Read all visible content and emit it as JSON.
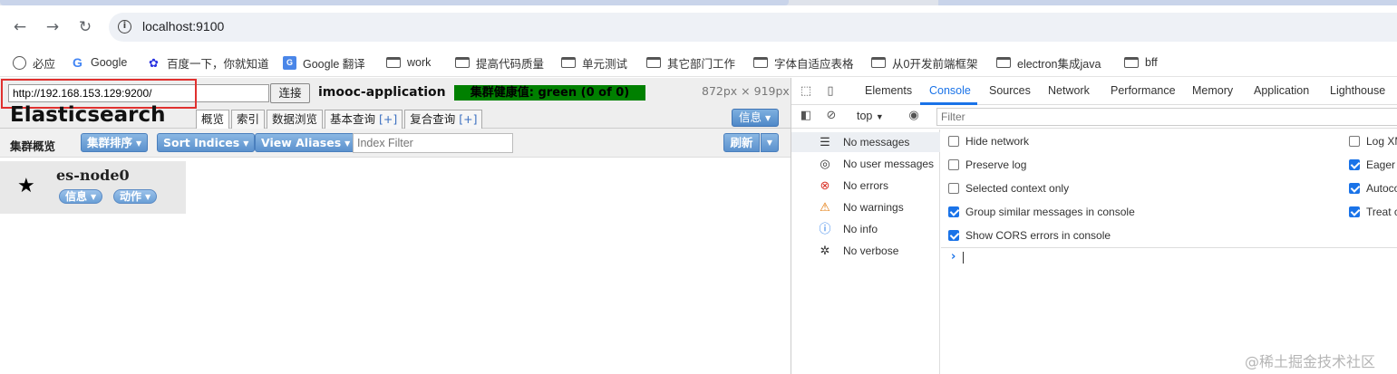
{
  "browser": {
    "url": "localhost:9100",
    "bookmarks": [
      {
        "label": "必应",
        "icon": "globe-icon"
      },
      {
        "label": "Google",
        "icon": "google-icon"
      },
      {
        "label": "百度一下，你就知道",
        "icon": "baidu-icon"
      },
      {
        "label": "Google 翻译",
        "icon": "google-translate-icon"
      },
      {
        "label": "work",
        "icon": "folder-icon"
      },
      {
        "label": "提高代码质量",
        "icon": "folder-icon"
      },
      {
        "label": "单元测试",
        "icon": "folder-icon"
      },
      {
        "label": "其它部门工作",
        "icon": "folder-icon"
      },
      {
        "label": "字体自适应表格",
        "icon": "folder-icon"
      },
      {
        "label": "从0开发前端框架",
        "icon": "folder-icon"
      },
      {
        "label": "electron集成java",
        "icon": "folder-icon"
      },
      {
        "label": "bff",
        "icon": "folder-icon"
      }
    ]
  },
  "head": {
    "uri_value": "http://192.168.153.129:9200/",
    "connect_label": "连接",
    "cluster_name": "imooc-application",
    "health_text": "集群健康值: green (0 of 0)",
    "dims": "872px × 919px",
    "logo": "Elasticsearch",
    "tabs": [
      {
        "label": "概览",
        "plus": ""
      },
      {
        "label": "索引",
        "plus": ""
      },
      {
        "label": "数据浏览",
        "plus": ""
      },
      {
        "label": "基本查询 ",
        "plus": "[+]"
      },
      {
        "label": "复合查询 ",
        "plus": "[+]"
      }
    ],
    "info_label": "信息"
  },
  "overview": {
    "title": "集群概览",
    "sort_label": "集群排序",
    "sort_indices_label": "Sort Indices",
    "view_aliases_label": "View Aliases",
    "index_filter_placeholder": "Index Filter",
    "refresh_label": "刷新"
  },
  "node": {
    "name": "es-node0",
    "info_label": "信息",
    "action_label": "动作"
  },
  "devtools": {
    "tabs": [
      "Elements",
      "Console",
      "Sources",
      "Network",
      "Performance",
      "Memory",
      "Application",
      "Lighthouse"
    ],
    "active_tab": "Console",
    "context": "top",
    "filter_placeholder": "Filter",
    "sidebar": [
      {
        "label": "No messages",
        "icon": "list-icon"
      },
      {
        "label": "No user messages",
        "icon": "user-icon"
      },
      {
        "label": "No errors",
        "icon": "error-icon"
      },
      {
        "label": "No warnings",
        "icon": "warning-icon"
      },
      {
        "label": "No info",
        "icon": "info-icon"
      },
      {
        "label": "No verbose",
        "icon": "bug-icon"
      }
    ],
    "settings_left": [
      {
        "label": "Hide network",
        "checked": false
      },
      {
        "label": "Preserve log",
        "checked": false
      },
      {
        "label": "Selected context only",
        "checked": false
      },
      {
        "label": "Group similar messages in console",
        "checked": true
      },
      {
        "label": "Show CORS errors in console",
        "checked": true
      }
    ],
    "settings_right": [
      {
        "label": "Log XM",
        "checked": false
      },
      {
        "label": "Eager e",
        "checked": true
      },
      {
        "label": "Autoco",
        "checked": true
      },
      {
        "label": "Treat c",
        "checked": true
      }
    ],
    "prompt": "›"
  },
  "watermark": "@稀土掘金技术社区",
  "colors": {
    "health_green": "#008000",
    "highlight_red": "#e0312f",
    "devtools_accent": "#1a73e8",
    "button_blue": "#5b91cd"
  }
}
